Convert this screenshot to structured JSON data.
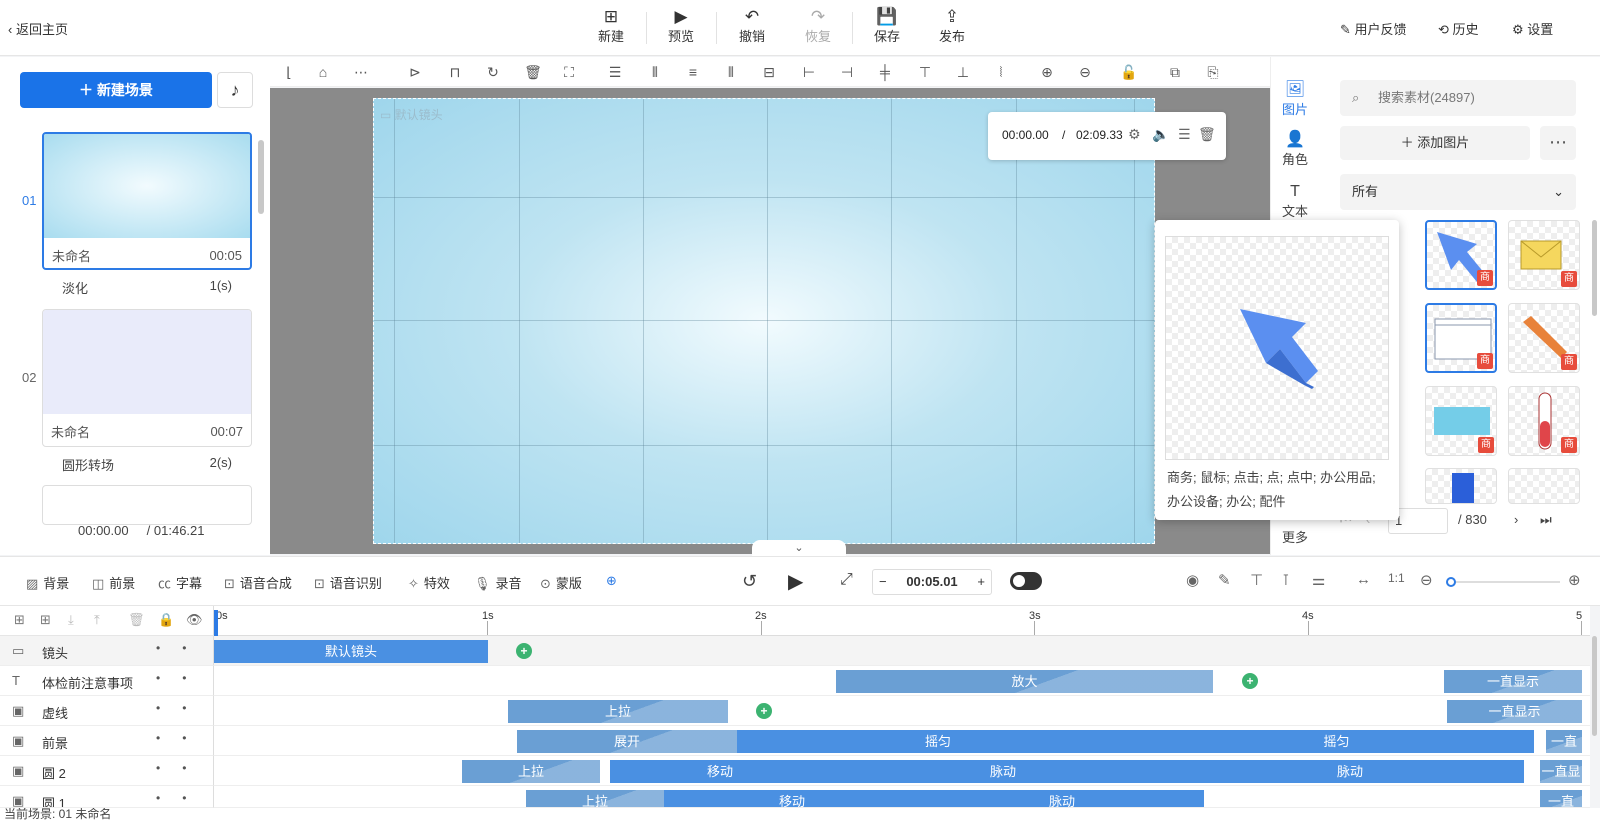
{
  "header": {
    "back_label": "返回主页",
    "actions": [
      {
        "label": "新建",
        "icon": "new-icon"
      },
      {
        "label": "预览",
        "icon": "play-icon"
      },
      {
        "label": "撤销",
        "icon": "undo-icon"
      },
      {
        "label": "恢复",
        "icon": "redo-icon",
        "disabled": true
      },
      {
        "label": "保存",
        "icon": "save-icon"
      },
      {
        "label": "发布",
        "icon": "publish-icon"
      }
    ],
    "feedback_label": "用户反馈",
    "history_label": "历史",
    "settings_label": "设置"
  },
  "scenes": {
    "new_scene_label": "新建场景",
    "items": [
      {
        "number": "01",
        "name": "未命名",
        "duration": "00:05",
        "transition": "淡化",
        "transition_time": "1(s)",
        "selected": true
      },
      {
        "number": "02",
        "name": "未命名",
        "duration": "00:07",
        "transition": "圆形转场",
        "transition_time": "2(s)",
        "selected": false
      }
    ],
    "current_time": "00:00.00",
    "total_time": "/ 01:46.21"
  },
  "canvas": {
    "camera_label": "默认镜头",
    "time_current": "00:00.00",
    "time_separator": "/",
    "time_total": "02:09.33"
  },
  "side_tabs": [
    {
      "label": "图片",
      "icon": "image-icon",
      "active": true
    },
    {
      "label": "角色",
      "icon": "character-icon"
    },
    {
      "label": "文本",
      "icon": "text-icon"
    },
    {
      "label": "更多",
      "icon": "more-icon"
    }
  ],
  "assets": {
    "search_placeholder": "搜索素材(24897)",
    "add_label": "添加图片",
    "filter_value": "所有",
    "badge": "商",
    "page_current": "1",
    "page_total": "/ 830",
    "preview_tags": "商务; 鼠标; 点击; 点; 点中; 办公用品; 办公设备; 办公; 配件"
  },
  "bottom_toolbar": {
    "items": [
      "背景",
      "前景",
      "字幕",
      "语音合成",
      "语音识别",
      "特效",
      "录音",
      "蒙版"
    ],
    "time_value": "00:05.01",
    "minus": "−",
    "plus": "+"
  },
  "timeline": {
    "ruler_labels": [
      "0s",
      "1s",
      "2s",
      "3s",
      "4s",
      "5"
    ],
    "tracks": [
      {
        "name": "镜头",
        "icon": "camera-track-icon"
      },
      {
        "name": "体检前注意事项",
        "icon": "text-track-icon"
      },
      {
        "name": "虚线",
        "icon": "image-track-icon"
      },
      {
        "name": "前景",
        "icon": "image-track-icon"
      },
      {
        "name": "圆 2",
        "icon": "image-track-icon"
      },
      {
        "name": "圆 1",
        "icon": "image-track-icon"
      }
    ],
    "segments": {
      "camera": [
        "默认镜头"
      ],
      "text": [
        "放大",
        "一直显示"
      ],
      "dashed": [
        "上拉",
        "一直显示"
      ],
      "foreground": [
        "展开",
        "摇匀",
        "摇匀",
        "一直"
      ],
      "circle2": [
        "上拉",
        "移动",
        "脉动",
        "脉动",
        "一直显"
      ],
      "circle1": [
        "上拉",
        "移动",
        "脉动",
        "一直"
      ]
    }
  },
  "status": {
    "text": "当前场景: 01   未命名"
  },
  "colors": {
    "accent": "#1a73e8",
    "segment": "#6a9fd4",
    "keyframe": "#3cb371",
    "badge": "#e74c3c"
  }
}
